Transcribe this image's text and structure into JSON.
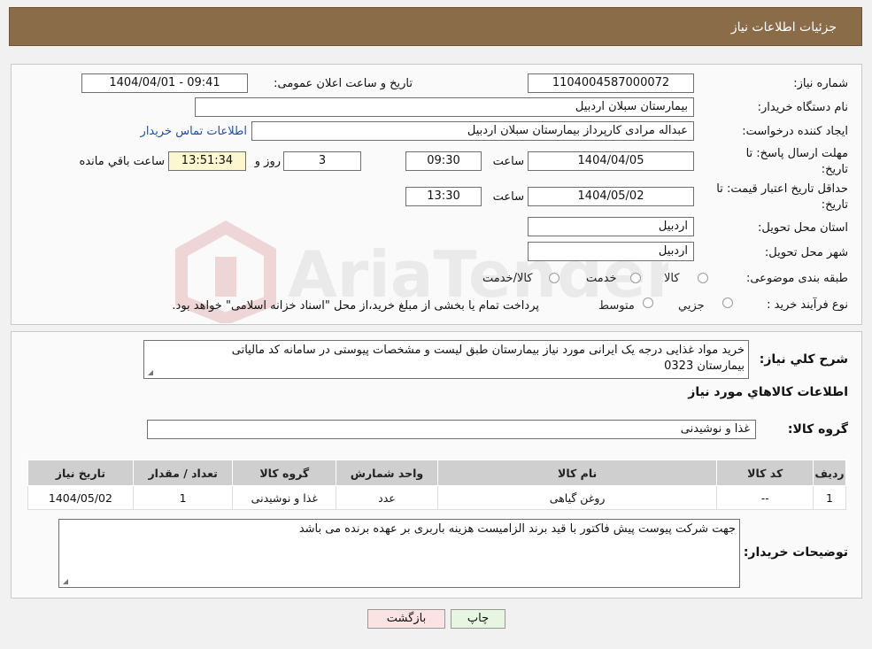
{
  "header": {
    "title": "جزئیات اطلاعات نیاز"
  },
  "form": {
    "need_number": {
      "label": "شماره نیاز:",
      "value": "1104004587000072"
    },
    "announce": {
      "label": "تاریخ و ساعت اعلان عمومی:",
      "value": "1404/04/01 - 09:41"
    },
    "buyer_org": {
      "label": "نام دستگاه خريدار:",
      "value": "بیمارستان سبلان اردبیل"
    },
    "creator": {
      "label": "ایجاد کننده درخواست:",
      "value": "عبداله مرادی کارپرداز بیمارستان سبلان اردبیل"
    },
    "contact_link": "اطلاعات تماس خريدار",
    "deadline": {
      "label_line1": "مهلت ارسال پاسخ: تا",
      "label_line2": "تاریخ:",
      "date": "1404/04/05",
      "time_label": "ساعت",
      "time": "09:30",
      "days": "3",
      "days_label": "روز و",
      "remaining": "13:51:34",
      "remaining_label": "ساعت باقي مانده"
    },
    "validity": {
      "label_line1": "حداقل تاریخ اعتبار قیمت: تا",
      "label_line2": "تاریخ:",
      "date": "1404/05/02",
      "time_label": "ساعت",
      "time": "13:30"
    },
    "province": {
      "label": "استان محل تحویل:",
      "value": "اردبیل"
    },
    "city": {
      "label": "شهر محل تحویل:",
      "value": "اردبیل"
    },
    "category": {
      "label": "طبقه بندی موضوعی:",
      "options": [
        "کالا",
        "خدمت",
        "کالا/خدمت"
      ]
    },
    "purchase_type": {
      "label": "نوع فرآیند خرید :",
      "options": [
        "جزیي",
        "متوسط"
      ],
      "note": "پرداخت تمام یا بخشی از مبلغ خرید،از محل \"اسناد خزانه اسلامی\" خواهد بود."
    }
  },
  "details": {
    "summary_label": "شرح كلي نياز:",
    "summary_line1": "خرید مواد غذایی درجه یک ایرانی مورد نیاز بیمارستان طبق لیست و مشخصات پیوستی در سامانه کد مالیاتی",
    "summary_line2": "بیمارستان 0323",
    "goods_info_title": "اطلاعات كالاهاي مورد نياز",
    "goods_group_label": "گروه کالا:",
    "goods_group_value": "غذا و نوشیدنی",
    "table": {
      "headers": [
        "ردیف",
        "کد کالا",
        "نام کالا",
        "واحد شمارش",
        "گروه کالا",
        "تعداد / مقدار",
        "تاریخ نیاز"
      ],
      "rows": [
        [
          "1",
          "--",
          "روغن گیاهی",
          "عدد",
          "غذا و نوشیدنی",
          "1",
          "1404/05/02"
        ]
      ]
    },
    "buyer_notes_label": "توضیحات خریدار:",
    "buyer_notes": "جهت شرکت پیوست پیش فاکتور با قید برند الزامیست هزینه باربری بر عهده برنده می باشد"
  },
  "buttons": {
    "print": "چاپ",
    "back": "بازگشت"
  },
  "watermark": "AriaTender.neT",
  "colors": {
    "header_bg": "#8a6d48",
    "remaining_bg": "#fdf7cf",
    "print_bg": "#e6f6e0",
    "back_bg": "#fbe3e3",
    "link": "#1a4fb0"
  }
}
